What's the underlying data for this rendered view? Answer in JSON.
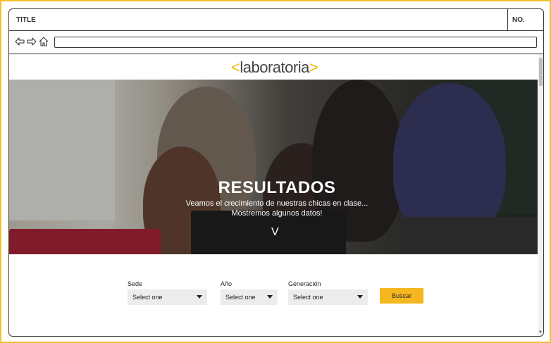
{
  "window": {
    "title": "TITLE",
    "number_label": "NO."
  },
  "browser": {
    "back_icon": "arrow-left-icon",
    "forward_icon": "arrow-right-icon",
    "home_icon": "home-icon",
    "url": ""
  },
  "header": {
    "logo_open": "<",
    "logo_text": "laboratoria",
    "logo_close": ">"
  },
  "hero": {
    "title": "RESULTADOS",
    "subtitle_line1": "Veamos el crecimiento de nuestras chicas en clase...",
    "subtitle_line2": "Mostremos algunos datos!",
    "arrow": "V"
  },
  "filters": {
    "sede": {
      "label": "Sede",
      "value": "Select one"
    },
    "anio": {
      "label": "Año",
      "value": "Select one"
    },
    "generacion": {
      "label": "Generación",
      "value": "Select one"
    },
    "button_label": "Buscar"
  },
  "colors": {
    "accent": "#f5b71f",
    "border": "#3a3a3a",
    "frame": "#f5c02e"
  }
}
